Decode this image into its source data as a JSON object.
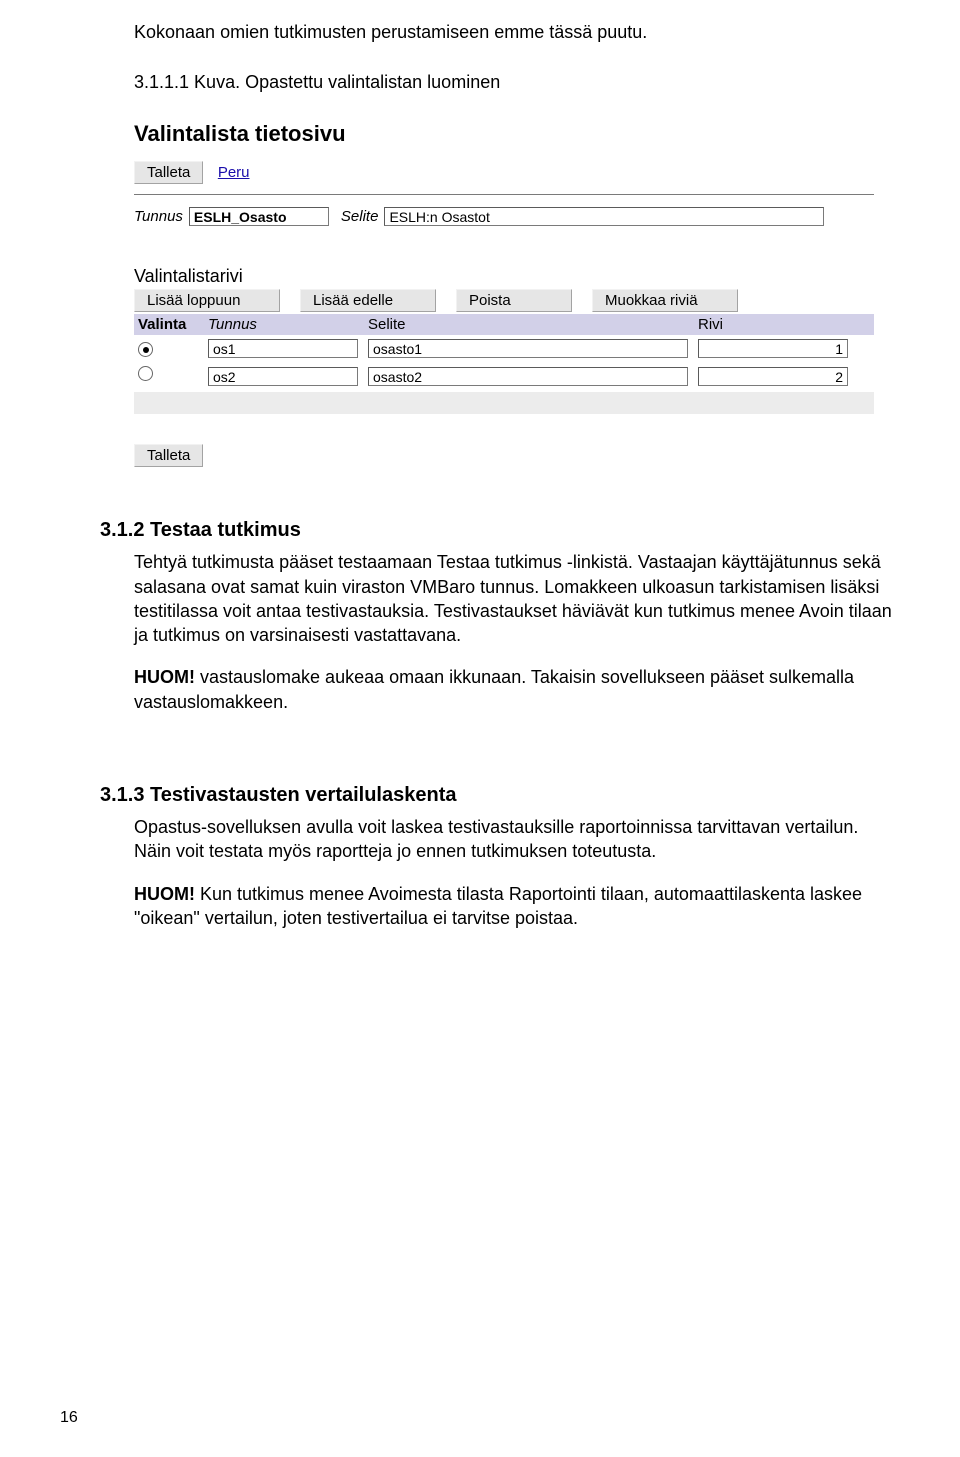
{
  "intro_text": "Kokonaan omien tutkimusten perustamiseen emme tässä puutu.",
  "fig_caption": "3.1.1.1 Kuva. Opastettu valintalistan luominen",
  "screenshot": {
    "title": "Valintalista tietosivu",
    "btn_talleta": "Talleta",
    "link_peru": "Peru",
    "label_tunnus": "Tunnus",
    "val_tunnus": "ESLH_Osasto",
    "label_selite": "Selite",
    "val_selite": "ESLH:n Osastot",
    "sub_valintalistarivi": "Valintalistarivi",
    "btn_lisaa_loppuun": "Lisää loppuun",
    "btn_lisaa_edelle": "Lisää edelle",
    "btn_poista": "Poista",
    "btn_muokkaa": "Muokkaa riviä",
    "hdr_valinta": "Valinta",
    "hdr_tunnus": "Tunnus",
    "hdr_selite": "Selite",
    "hdr_rivi": "Rivi",
    "rows": [
      {
        "tunnus": "os1",
        "selite": "osasto1",
        "rivi": "1",
        "selected": true
      },
      {
        "tunnus": "os2",
        "selite": "osasto2",
        "rivi": "2",
        "selected": false
      }
    ],
    "btn_talleta2": "Talleta"
  },
  "sec312": {
    "title": "3.1.2 Testaa tutkimus",
    "p1": "Tehtyä tutkimusta pääset testaamaan Testaa tutkimus -linkistä. Vastaajan käyttäjätunnus sekä salasana ovat samat kuin viraston VMBaro tunnus. Lomakkeen ulkoasun tarkistamisen lisäksi testitilassa voit antaa testivastauksia. Testivastaukset häviävät kun tutkimus menee Avoin tilaan ja tutkimus on varsinaisesti vastattavana.",
    "huom_label": "HUOM!",
    "huom_text": " vastauslomake aukeaa omaan ikkunaan. Takaisin sovellukseen pääset sulkemalla vastauslomakkeen."
  },
  "sec313": {
    "title": "3.1.3 Testivastausten vertailulaskenta",
    "p1": "Opastus-sovelluksen avulla voit laskea testivastauksille raportoinnissa tarvittavan vertailun. Näin voit testata myös raportteja jo ennen tutkimuksen toteutusta.",
    "huom_label": "HUOM!",
    "huom_text": " Kun tutkimus menee Avoimesta tilasta Raportointi tilaan, automaattilaskenta laskee \"oikean\" vertailun, joten testivertailua ei tarvitse poistaa."
  },
  "page_number": "16"
}
